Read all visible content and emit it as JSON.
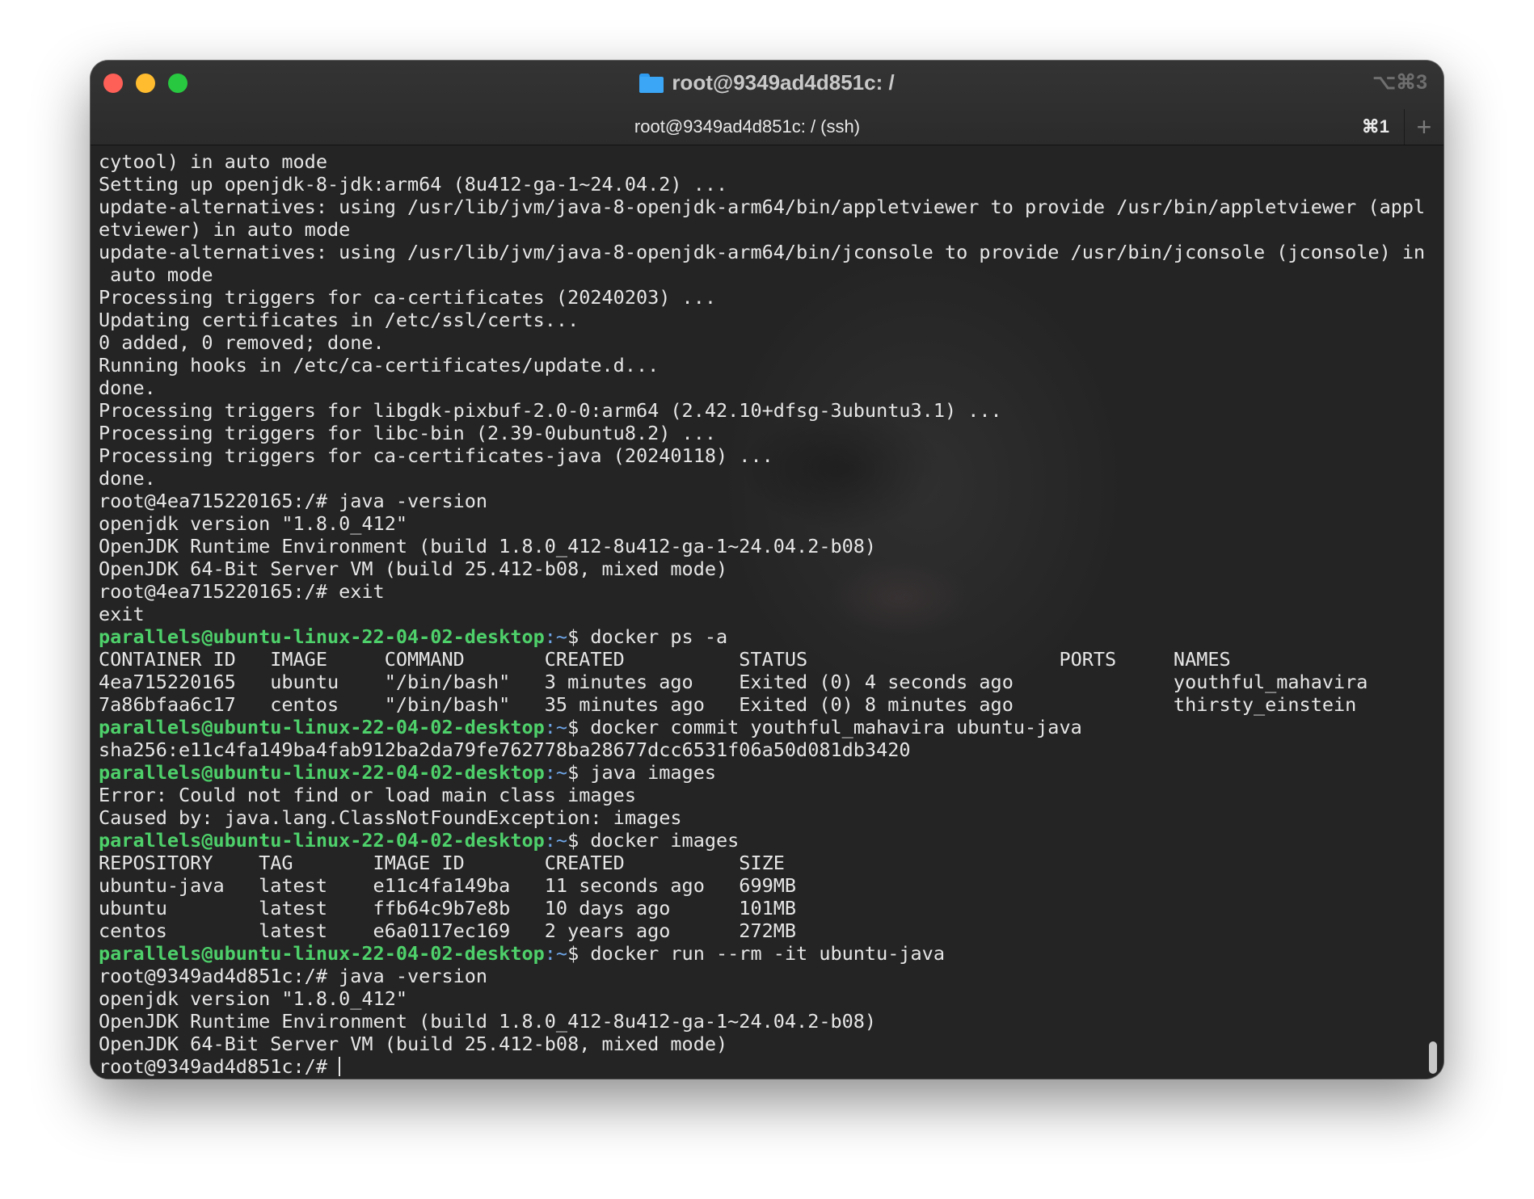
{
  "window": {
    "title": "root@9349ad4d851c: /",
    "shortcut": "⌥⌘3",
    "tab_label": "root@9349ad4d851c: / (ssh)",
    "tab_shortcut": "⌘1",
    "new_tab_label": "+"
  },
  "colors": {
    "prompt_user": "#4ed06a",
    "prompt_path": "#6fa6e8",
    "text": "#e6e6e6"
  },
  "terminal": {
    "lines": [
      {
        "text": "cytool) in auto mode"
      },
      {
        "text": "Setting up openjdk-8-jdk:arm64 (8u412-ga-1~24.04.2) ..."
      },
      {
        "text": "update-alternatives: using /usr/lib/jvm/java-8-openjdk-arm64/bin/appletviewer to provide /usr/bin/appletviewer (appl"
      },
      {
        "text": "etviewer) in auto mode"
      },
      {
        "text": "update-alternatives: using /usr/lib/jvm/java-8-openjdk-arm64/bin/jconsole to provide /usr/bin/jconsole (jconsole) in"
      },
      {
        "text": " auto mode"
      },
      {
        "text": "Processing triggers for ca-certificates (20240203) ..."
      },
      {
        "text": "Updating certificates in /etc/ssl/certs..."
      },
      {
        "text": "0 added, 0 removed; done."
      },
      {
        "text": "Running hooks in /etc/ca-certificates/update.d..."
      },
      {
        "text": "done."
      },
      {
        "text": "Processing triggers for libgdk-pixbuf-2.0-0:arm64 (2.42.10+dfsg-3ubuntu3.1) ..."
      },
      {
        "text": "Processing triggers for libc-bin (2.39-0ubuntu8.2) ..."
      },
      {
        "text": "Processing triggers for ca-certificates-java (20240118) ..."
      },
      {
        "text": "done."
      },
      {
        "text": "root@4ea715220165:/# java -version"
      },
      {
        "text": "openjdk version \"1.8.0_412\""
      },
      {
        "text": "OpenJDK Runtime Environment (build 1.8.0_412-8u412-ga-1~24.04.2-b08)"
      },
      {
        "text": "OpenJDK 64-Bit Server VM (build 25.412-b08, mixed mode)"
      },
      {
        "text": "root@4ea715220165:/# exit"
      },
      {
        "text": "exit"
      },
      {
        "user": "parallels@ubuntu-linux-22-04-02-desktop",
        "path": ":~",
        "cmd": "$ docker ps -a"
      },
      {
        "text": "CONTAINER ID   IMAGE     COMMAND       CREATED          STATUS                      PORTS     NAMES"
      },
      {
        "text": "4ea715220165   ubuntu    \"/bin/bash\"   3 minutes ago    Exited (0) 4 seconds ago              youthful_mahavira"
      },
      {
        "text": "7a86bfaa6c17   centos    \"/bin/bash\"   35 minutes ago   Exited (0) 8 minutes ago              thirsty_einstein"
      },
      {
        "user": "parallels@ubuntu-linux-22-04-02-desktop",
        "path": ":~",
        "cmd": "$ docker commit youthful_mahavira ubuntu-java"
      },
      {
        "text": "sha256:e11c4fa149ba4fab912ba2da79fe762778ba28677dcc6531f06a50d081db3420"
      },
      {
        "user": "parallels@ubuntu-linux-22-04-02-desktop",
        "path": ":~",
        "cmd": "$ java images"
      },
      {
        "text": "Error: Could not find or load main class images"
      },
      {
        "text": "Caused by: java.lang.ClassNotFoundException: images"
      },
      {
        "user": "parallels@ubuntu-linux-22-04-02-desktop",
        "path": ":~",
        "cmd": "$ docker images"
      },
      {
        "text": "REPOSITORY    TAG       IMAGE ID       CREATED          SIZE"
      },
      {
        "text": "ubuntu-java   latest    e11c4fa149ba   11 seconds ago   699MB"
      },
      {
        "text": "ubuntu        latest    ffb64c9b7e8b   10 days ago      101MB"
      },
      {
        "text": "centos        latest    e6a0117ec169   2 years ago      272MB"
      },
      {
        "user": "parallels@ubuntu-linux-22-04-02-desktop",
        "path": ":~",
        "cmd": "$ docker run --rm -it ubuntu-java"
      },
      {
        "text": "root@9349ad4d851c:/# java -version"
      },
      {
        "text": "openjdk version \"1.8.0_412\""
      },
      {
        "text": "OpenJDK Runtime Environment (build 1.8.0_412-8u412-ga-1~24.04.2-b08)"
      },
      {
        "text": "OpenJDK 64-Bit Server VM (build 25.412-b08, mixed mode)"
      }
    ],
    "current_prompt": "root@9349ad4d851c:/# "
  }
}
